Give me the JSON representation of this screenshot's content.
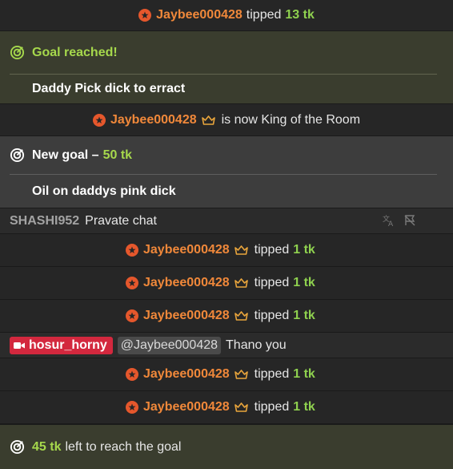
{
  "tips": [
    {
      "user": "Jaybee000428",
      "action": "tipped",
      "amount": "13 tk",
      "crown": false
    },
    {
      "user": "Jaybee000428",
      "action": "tipped",
      "amount": "1 tk",
      "crown": true
    },
    {
      "user": "Jaybee000428",
      "action": "tipped",
      "amount": "1 tk",
      "crown": true
    },
    {
      "user": "Jaybee000428",
      "action": "tipped",
      "amount": "1 tk",
      "crown": true
    },
    {
      "user": "Jaybee000428",
      "action": "tipped",
      "amount": "1 tk",
      "crown": true
    },
    {
      "user": "Jaybee000428",
      "action": "tipped",
      "amount": "1 tk",
      "crown": true
    }
  ],
  "goal_reached": {
    "title": "Goal reached!",
    "description": "Daddy Pick dick to erract"
  },
  "king": {
    "user": "Jaybee000428",
    "text": "is now King of the Room"
  },
  "new_goal": {
    "prefix": "New goal –",
    "amount": "50 tk",
    "description": "Oil on daddys pink dick"
  },
  "chat1": {
    "user": "SHASHI952",
    "message": "Pravate chat"
  },
  "chat2": {
    "user": "hosur_horny",
    "mention": "@Jaybee000428",
    "message": "Thano you"
  },
  "final_goal": {
    "amount": "45 tk",
    "text": "left to reach the goal"
  },
  "colors": {
    "username": "#f0883a",
    "tokens": "#8fd14f",
    "goal_bg": "#3a3d2e",
    "red_tag": "#d3283e"
  }
}
